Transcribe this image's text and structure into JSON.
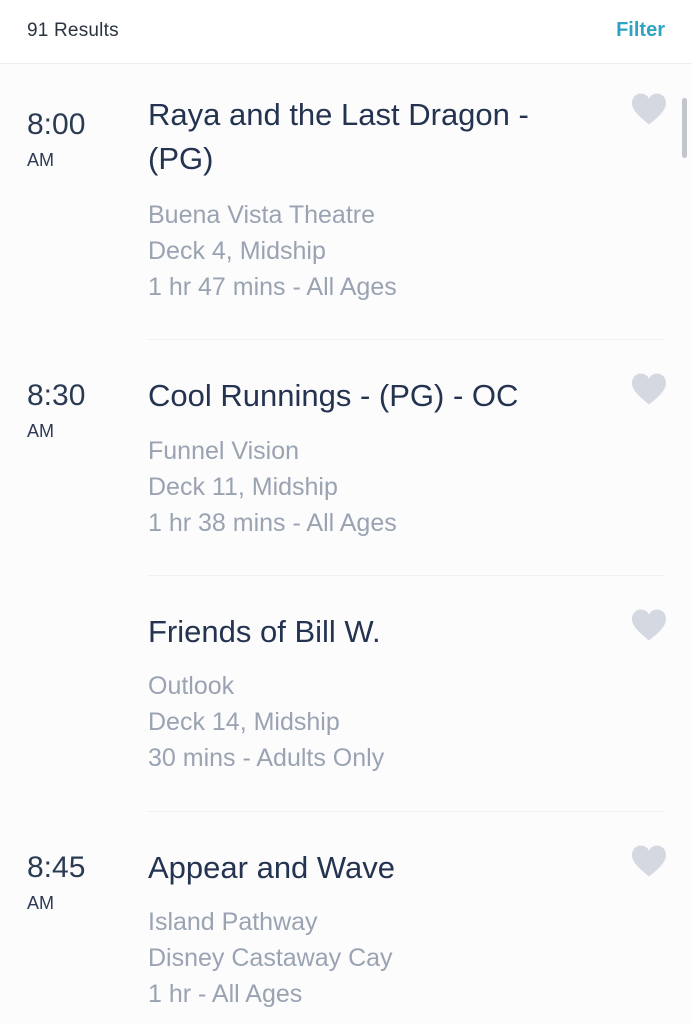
{
  "header": {
    "results_label": "91 Results",
    "filter_label": "Filter"
  },
  "colors": {
    "accent": "#2fa3c2",
    "title_text": "#243350",
    "secondary_text": "#9aa3b2",
    "heart_icon": "#d4d8e0"
  },
  "events": [
    {
      "time": "8:00",
      "ampm": "AM",
      "title_line1": "Raya and the Last Dragon -",
      "title_line2": "(PG)",
      "venue": "Buena Vista Theatre",
      "location": "Deck 4, Midship",
      "duration": "1 hr 47 mins - All Ages",
      "favorite_icon": "heart-icon"
    },
    {
      "time": "8:30",
      "ampm": "AM",
      "title_line1": "Cool Runnings - (PG) - OC",
      "venue": "Funnel Vision",
      "location": "Deck 11, Midship",
      "duration": "1 hr 38 mins - All Ages",
      "favorite_icon": "heart-icon"
    },
    {
      "time": "",
      "ampm": "",
      "title_line1": "Friends of Bill W.",
      "venue": "Outlook",
      "location": "Deck 14, Midship",
      "duration": "30 mins - Adults Only",
      "favorite_icon": "heart-icon"
    },
    {
      "time": "8:45",
      "ampm": "AM",
      "title_line1": "Appear and Wave",
      "venue": "Island Pathway",
      "location": "Disney Castaway Cay",
      "duration": "1 hr - All Ages",
      "favorite_icon": "heart-icon"
    }
  ]
}
